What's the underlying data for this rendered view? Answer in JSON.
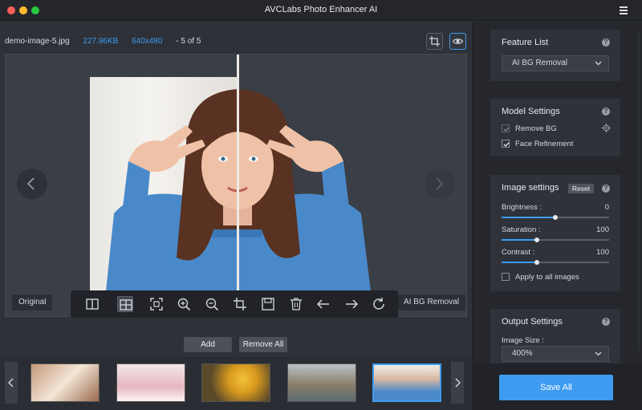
{
  "app": {
    "title": "AVCLabs Photo Enhancer AI"
  },
  "file": {
    "name": "demo-image-5.jpg",
    "size": "227.96KB",
    "dimensions": "640x480",
    "position": "- 5 of 5"
  },
  "viewer": {
    "left_label": "Original",
    "right_label": "AI BG Removal"
  },
  "toolbar": {
    "tools": [
      "split-view-icon",
      "compare-view-icon",
      "fit-screen-icon",
      "zoom-in-icon",
      "zoom-out-icon",
      "crop-icon",
      "save-icon",
      "delete-icon",
      "arrow-left-icon",
      "arrow-right-icon",
      "rotate-icon"
    ],
    "active_tool": "compare-view-icon"
  },
  "actions": {
    "add_label": "Add",
    "remove_all_label": "Remove All"
  },
  "thumbnails": {
    "count": 5,
    "selected_index": 4
  },
  "feature_list": {
    "title": "Feature List",
    "selected": "AI BG Removal"
  },
  "model_settings": {
    "title": "Model Settings",
    "options": [
      {
        "label": "Remove BG",
        "checked": true,
        "disabled": true
      },
      {
        "label": "Face Refinement",
        "checked": true,
        "disabled": false
      }
    ]
  },
  "image_settings": {
    "title": "Image settings",
    "reset_label": "Reset",
    "sliders": [
      {
        "label": "Brightness :",
        "value": "0",
        "fraction": 0.5
      },
      {
        "label": "Saturation :",
        "value": "100",
        "fraction": 0.33
      },
      {
        "label": "Contrast :",
        "value": "100",
        "fraction": 0.33
      }
    ],
    "apply_all_label": "Apply to all images"
  },
  "output_settings": {
    "title": "Output Settings",
    "image_size_label": "Image Size :",
    "image_size": "400%"
  },
  "save": {
    "label": "Save All"
  },
  "colors": {
    "accent": "#3e9bf0",
    "panel": "#2f3239",
    "background": "#2b2e35"
  }
}
